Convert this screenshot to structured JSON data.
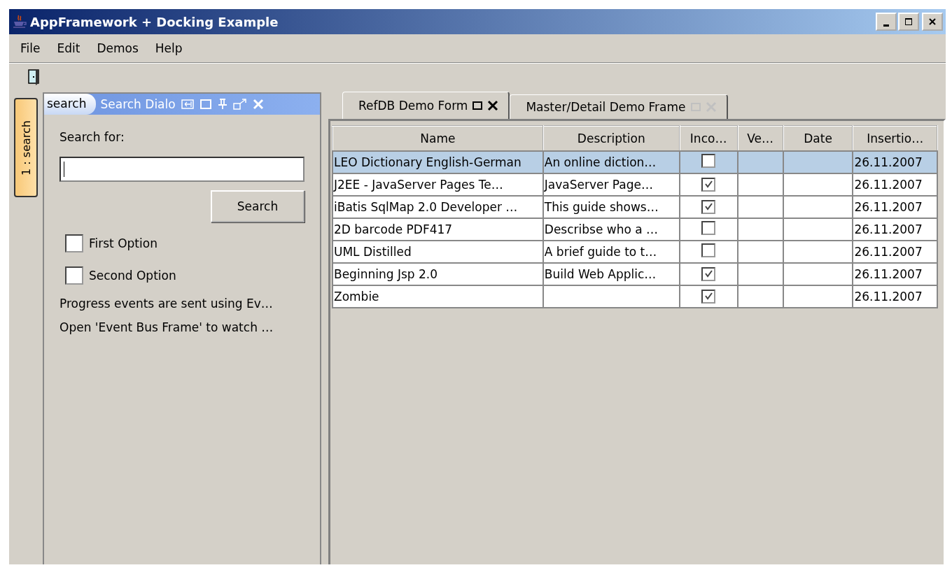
{
  "window": {
    "title": "AppFramework + Docking Example"
  },
  "menu": [
    "File",
    "Edit",
    "Demos",
    "Help"
  ],
  "side_tabs": [
    {
      "label": "1 : search",
      "selected": true
    }
  ],
  "panel": {
    "tab": "search",
    "title": "Search Dialo",
    "search_label": "Search for:",
    "search_button": "Search",
    "options": [
      {
        "label": "First Option",
        "checked": false
      },
      {
        "label": "Second Option",
        "checked": false
      }
    ],
    "notes": [
      "Progress events are sent using Ev…",
      "Open 'Event Bus Frame' to watch …"
    ]
  },
  "tabs": [
    {
      "label": "RefDB Demo Form",
      "selected": true
    },
    {
      "label": "Master/Detail Demo Frame",
      "selected": false
    }
  ],
  "table": {
    "columns": [
      "Name",
      "Description",
      "Inco…",
      "Ve…",
      "Date",
      "Insertio…"
    ],
    "rows": [
      {
        "name": "LEO Dictionary English-German",
        "description": "An online diction…",
        "incomplete": false,
        "inserted": "26.11.2007",
        "selected": true
      },
      {
        "name": "J2EE - JavaServer Pages Te…",
        "description": "JavaServer Page…",
        "incomplete": true,
        "inserted": "26.11.2007",
        "selected": false
      },
      {
        "name": "iBatis SqlMap 2.0 Developer …",
        "description": "This guide shows…",
        "incomplete": true,
        "inserted": "26.11.2007",
        "selected": false
      },
      {
        "name": "2D barcode PDF417",
        "description": "Describse who a …",
        "incomplete": false,
        "inserted": "26.11.2007",
        "selected": false
      },
      {
        "name": "UML Distilled",
        "description": "A brief guide to t…",
        "incomplete": false,
        "inserted": "26.11.2007",
        "selected": false
      },
      {
        "name": "Beginning Jsp 2.0",
        "description": "Build Web Applic…",
        "incomplete": true,
        "inserted": "26.11.2007",
        "selected": false
      },
      {
        "name": "Zombie",
        "description": "",
        "incomplete": true,
        "inserted": "26.11.2007",
        "selected": false
      }
    ]
  }
}
